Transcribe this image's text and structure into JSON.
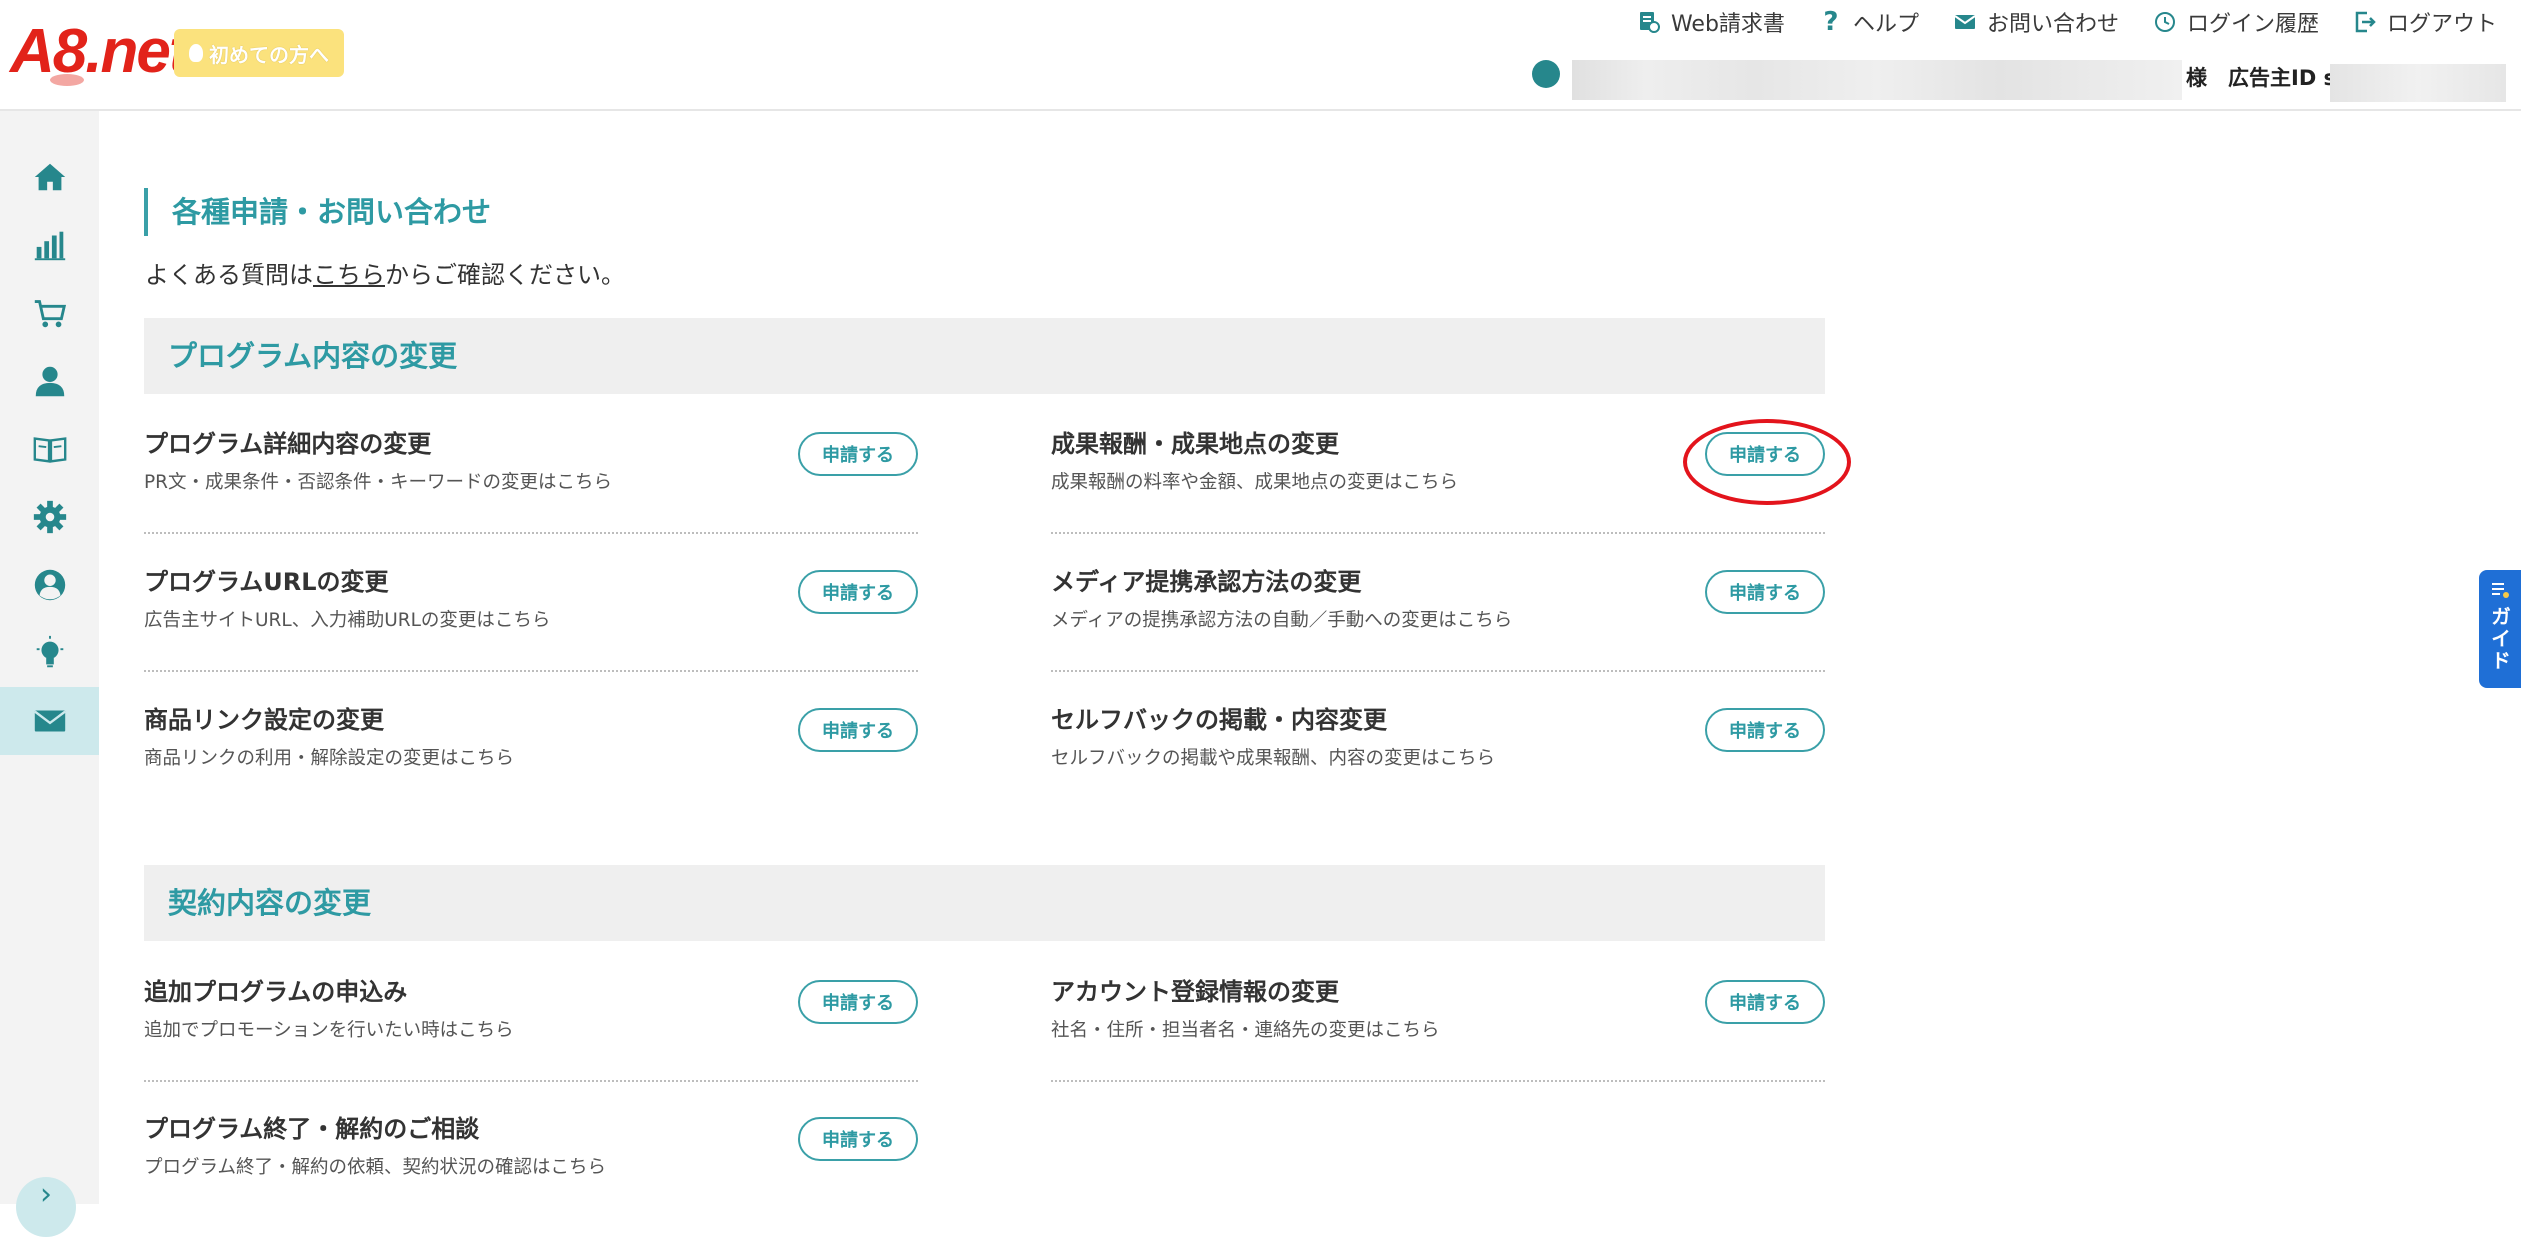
{
  "header": {
    "logo": "A8.net",
    "first_time": "初めての方へ",
    "links": [
      {
        "label": "Web請求書",
        "icon": "invoice-icon"
      },
      {
        "label": "ヘルプ",
        "icon": "help-icon"
      },
      {
        "label": "お問い合わせ",
        "icon": "mail-icon"
      },
      {
        "label": "ログイン履歴",
        "icon": "history-icon"
      },
      {
        "label": "ログアウト",
        "icon": "logout-icon"
      }
    ],
    "user_suffix": "様　広告主ID s"
  },
  "sidebar": {
    "items": [
      {
        "icon": "home-icon"
      },
      {
        "icon": "chart-icon"
      },
      {
        "icon": "cart-icon"
      },
      {
        "icon": "person-icon"
      },
      {
        "icon": "book-icon"
      },
      {
        "icon": "gear-icon"
      },
      {
        "icon": "account-icon"
      },
      {
        "icon": "lightbulb-icon"
      },
      {
        "icon": "mail-icon",
        "active": true
      }
    ],
    "expand": "›"
  },
  "main": {
    "title": "各種申請・お問い合わせ",
    "intro_before": "よくある質問は",
    "intro_link": "こちら",
    "intro_after": "からご確認ください。",
    "sections": [
      {
        "title": "プログラム内容の変更",
        "items": [
          {
            "title": "プログラム詳細内容の変更",
            "desc": "PR文・成果条件・否認条件・キーワードの変更はこちら",
            "button": "申請する"
          },
          {
            "title": "成果報酬・成果地点の変更",
            "desc": "成果報酬の料率や金額、成果地点の変更はこちら",
            "button": "申請する"
          },
          {
            "title": "プログラムURLの変更",
            "desc": "広告主サイトURL、入力補助URLの変更はこちら",
            "button": "申請する"
          },
          {
            "title": "メディア提携承認方法の変更",
            "desc": "メディアの提携承認方法の自動／手動への変更はこちら",
            "button": "申請する"
          },
          {
            "title": "商品リンク設定の変更",
            "desc": "商品リンクの利用・解除設定の変更はこちら",
            "button": "申請する"
          },
          {
            "title": "セルフバックの掲載・内容変更",
            "desc": "セルフバックの掲載や成果報酬、内容の変更はこちら",
            "button": "申請する"
          }
        ]
      },
      {
        "title": "契約内容の変更",
        "items": [
          {
            "title": "追加プログラムの申込み",
            "desc": "追加でプロモーションを行いたい時はこちら",
            "button": "申請する"
          },
          {
            "title": "アカウント登録情報の変更",
            "desc": "社名・住所・担当者名・連絡先の変更はこちら",
            "button": "申請する"
          },
          {
            "title": "プログラム終了・解約のご相談",
            "desc": "プログラム終了・解約の依頼、契約状況の確認はこちら",
            "button": "申請する"
          }
        ]
      }
    ]
  },
  "guide": {
    "label": "ガイド"
  },
  "colors": {
    "accent": "#2e9aa3",
    "brand": "#e2231a",
    "highlight": "#e3141c",
    "guide": "#1f6fd6"
  }
}
